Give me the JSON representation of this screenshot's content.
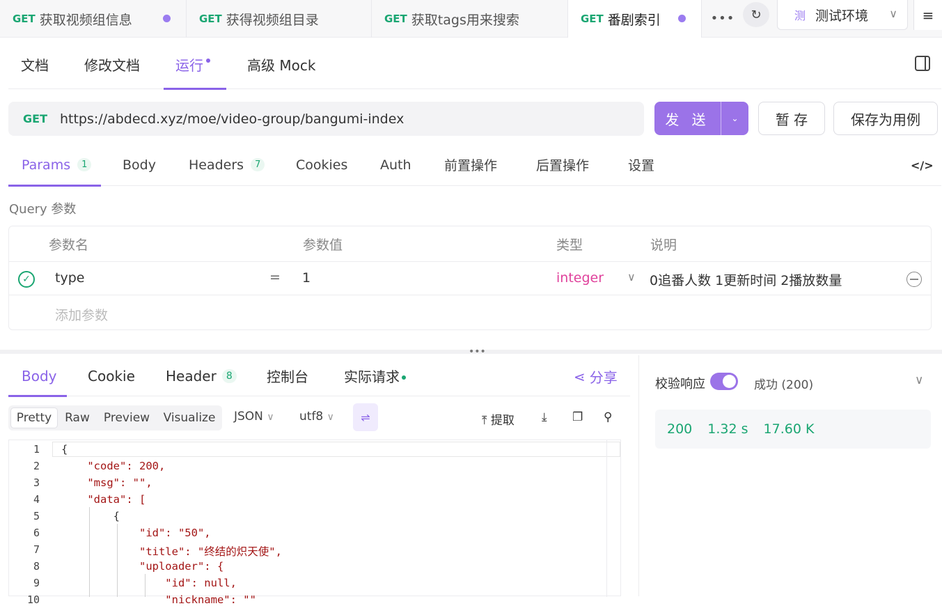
{
  "request_tabs": [
    {
      "method": "GET",
      "name": "获取视频组信息",
      "dirty": true
    },
    {
      "method": "GET",
      "name": "获得视频组目录",
      "dirty": false
    },
    {
      "method": "GET",
      "name": "获取tags用来搜索",
      "dirty": false
    },
    {
      "method": "GET",
      "name": "番剧索引",
      "dirty": true,
      "active": true
    }
  ],
  "more_tabs_label": "•••",
  "refresh_icon": "↻",
  "env": {
    "badge": "测",
    "name": "测试环境",
    "chevron": "∨"
  },
  "menu_icon": "≡",
  "sub_tabs": [
    "文档",
    "修改文档",
    "运行",
    "高级 Mock"
  ],
  "active_sub_tab": "运行",
  "url": {
    "method": "GET",
    "value": "https://abdecd.xyz/moe/video-group/bangumi-index"
  },
  "buttons": {
    "send": "发 送",
    "send_caret": "⌄",
    "temp_save": "暂 存",
    "save_case": "保存为用例"
  },
  "param_tabs": [
    {
      "label": "Params",
      "count": "1"
    },
    {
      "label": "Body"
    },
    {
      "label": "Headers",
      "count": "7"
    },
    {
      "label": "Cookies"
    },
    {
      "label": "Auth"
    },
    {
      "label": "前置操作"
    },
    {
      "label": "后置操作"
    },
    {
      "label": "设置"
    }
  ],
  "code_icon": "</>",
  "query_label": "Query 参数",
  "param_table": {
    "headers": [
      "参数名",
      "参数值",
      "类型",
      "说明"
    ],
    "rows": [
      {
        "name": "type",
        "eq": "=",
        "value": "1",
        "type": "integer",
        "type_chevron": "∨",
        "desc": "0追番人数 1更新时间 2播放数量",
        "check": "✓"
      }
    ],
    "add_placeholder": "添加参数"
  },
  "splitter_handle": "•••",
  "response_tabs": [
    {
      "label": "Body"
    },
    {
      "label": "Cookie"
    },
    {
      "label": "Header",
      "count": "8"
    },
    {
      "label": "控制台"
    },
    {
      "label": "实际请求"
    }
  ],
  "share": {
    "icon": "⋖",
    "label": "分享"
  },
  "view_modes": [
    "Pretty",
    "Raw",
    "Preview",
    "Visualize"
  ],
  "format": {
    "lang": "JSON",
    "encoding": "utf8",
    "chevron": "∨"
  },
  "wrap_icon": "⇌",
  "toolbar": {
    "extract_icon": "⤒",
    "extract_label": "提取",
    "download_icon": "⤓",
    "copy_icon": "❐",
    "search_icon": "⚲"
  },
  "code_lines": [
    "{",
    "    \"code\": 200,",
    "    \"msg\": \"\",",
    "    \"data\": [",
    "        {",
    "            \"id\": \"50\",",
    "            \"title\": \"终结的炽天使\",",
    "            \"uploader\": {",
    "                \"id\": null,",
    "                \"nickname\": \"\""
  ],
  "line_numbers": [
    "1",
    "2",
    "3",
    "4",
    "5",
    "6",
    "7",
    "8",
    "9",
    "10"
  ],
  "validate": {
    "label": "校验响应",
    "status": "成功 (200)",
    "chevron": "∨"
  },
  "stats": {
    "status": "200",
    "time": "1.32 s",
    "size": "17.60 K"
  },
  "colors": {
    "accent": "#8a63e8",
    "get": "#1aa672",
    "integer": "#e0429c"
  }
}
